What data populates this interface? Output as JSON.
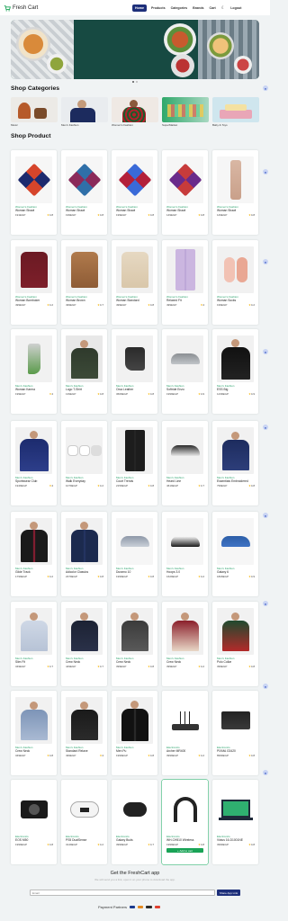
{
  "nav": {
    "brand": "Fresh Cart",
    "links": [
      "Home",
      "Products",
      "Categories",
      "Brands",
      "Cart"
    ],
    "logout": "Logout"
  },
  "sections": {
    "categories_title": "Shop Categories",
    "products_title": "Shop Product"
  },
  "categories": [
    "Music",
    "Men's Fashion",
    "Women's Fashion",
    "SuperMarket",
    "Baby & Toys"
  ],
  "products": [
    {
      "cat": "Women's Fashion",
      "name": "Woman Shawl",
      "price": "191EGP",
      "rating": "4.8"
    },
    {
      "cat": "Women's Fashion",
      "name": "Woman Shawl",
      "price": "199EGP",
      "rating": "4.8"
    },
    {
      "cat": "Women's Fashion",
      "name": "Woman Shawl",
      "price": "199EGP",
      "rating": "4.8"
    },
    {
      "cat": "Women's Fashion",
      "name": "Woman Shawl",
      "price": "149EGP",
      "rating": "4.8"
    },
    {
      "cat": "Women's Fashion",
      "name": "Woman Shawl",
      "price": "149EGP",
      "rating": "4.8"
    },
    {
      "cat": "Women's Fashion",
      "name": "Woman Bomboker",
      "price": "499EGP",
      "rating": "4.2"
    },
    {
      "cat": "Women's Fashion",
      "name": "Woman Brown",
      "price": "499EGP",
      "rating": "4.7"
    },
    {
      "cat": "Women's Fashion",
      "name": "Woman Standard",
      "price": "499EGP",
      "rating": "4.8"
    },
    {
      "cat": "Women's Fashion",
      "name": "Relaxed Fit",
      "price": "499EGP",
      "rating": "4"
    },
    {
      "cat": "Women's Fashion",
      "name": "Woman Socks",
      "price": "199EGP",
      "rating": "4.2"
    },
    {
      "cat": "Men's Fashion",
      "name": "Woman Karma",
      "price": "199EGP",
      "rating": "4"
    },
    {
      "cat": "Men's Fashion",
      "name": "Logo T-Shirt",
      "price": "139EGP",
      "rating": "4.8"
    },
    {
      "cat": "Men's Fashion",
      "name": "Orca Leather",
      "price": "3609EGP",
      "rating": "4.8"
    },
    {
      "cat": "Men's Fashion",
      "name": "Softride Enzo",
      "price": "1999EGP",
      "rating": "4.9"
    },
    {
      "cat": "Men's Fashion",
      "name": "ESS Big",
      "price": "1239EGP",
      "rating": "4.9"
    },
    {
      "cat": "Men's Fashion",
      "name": "Sportswear Club",
      "price": "1949EGP",
      "rating": "4"
    },
    {
      "cat": "Men's Fashion",
      "name": "Walk Everyday",
      "price": "1079EGP",
      "rating": "4.2"
    },
    {
      "cat": "Men's Fashion",
      "name": "Court Trends",
      "price": "2159EGP",
      "rating": "4.8"
    },
    {
      "cat": "Men's Fashion",
      "name": "Heard Line",
      "price": "4619EGP",
      "rating": "4.7"
    },
    {
      "cat": "Men's Fashion",
      "name": "Essentials Embroidered",
      "price": "799EGP",
      "rating": "4.8"
    },
    {
      "cat": "Men's Fashion",
      "name": "Glide Track",
      "price": "1799EGP",
      "rating": "4.2"
    },
    {
      "cat": "Men's Fashion",
      "name": "Adicolor Classics",
      "price": "2379EGP",
      "rating": "4.8"
    },
    {
      "cat": "Men's Fashion",
      "name": "Duramo 10",
      "price": "1999EGP",
      "rating": "4.8"
    },
    {
      "cat": "Men's Fashion",
      "name": "Hoops 3.0",
      "price": "1629EGP",
      "rating": "4.2"
    },
    {
      "cat": "Men's Fashion",
      "name": "Galaxy 6",
      "price": "1829EGP",
      "rating": "4.9"
    },
    {
      "cat": "Men's Fashion",
      "name": "Slim Fit",
      "price": "349EGP",
      "rating": "4.7"
    },
    {
      "cat": "Men's Fashion",
      "name": "Crew Neck",
      "price": "449EGP",
      "rating": "4.7"
    },
    {
      "cat": "Men's Fashion",
      "name": "Crew Neck",
      "price": "399EGP",
      "rating": "4.8"
    },
    {
      "cat": "Men's Fashion",
      "name": "Crew Neck",
      "price": "399EGP",
      "rating": "4.2"
    },
    {
      "cat": "Men's Fashion",
      "name": "Polo Collar",
      "price": "399EGP",
      "rating": "4.8"
    },
    {
      "cat": "Men's Fashion",
      "name": "Crew Neck",
      "price": "349EGP",
      "rating": "4.8"
    },
    {
      "cat": "Men's Fashion",
      "name": "Standard Relaxe",
      "price": "499EGP",
      "rating": "4"
    },
    {
      "cat": "Men's Fashion",
      "name": "Men Pu",
      "price": "1999EGP",
      "rating": "4.8"
    },
    {
      "cat": "Electronics",
      "name": "Archer MR400",
      "price": "3999EGP",
      "rating": "4.2"
    },
    {
      "cat": "Electronics",
      "name": "PIXMA G3420",
      "price": "8999EGP",
      "rating": "4.8"
    },
    {
      "cat": "Electronics",
      "name": "EOS M50",
      "price": "1999EGP",
      "rating": "4.8"
    },
    {
      "cat": "Electronics",
      "name": "PS5 DualSense",
      "price": "3149EGP",
      "rating": "4.2"
    },
    {
      "cat": "Electronics",
      "name": "Galaxy Buds",
      "price": "3999EGP",
      "rating": "4.7"
    },
    {
      "cat": "Electronics",
      "name": "WH-CH510 Wireless",
      "price": "1999EGP",
      "rating": "4.8"
    },
    {
      "cat": "Electronics",
      "name": "Victus 16-D1001NE",
      "price": "3999EGP",
      "rating": "4.8"
    }
  ],
  "add_to_cart": "+ Add to cart",
  "icons": [
    "cart-logo-icon",
    "moon-icon",
    "star-icon"
  ],
  "app_section": {
    "title": "Get the FreshCart app",
    "subtitle": "We will send you a link, open it on your phone to download the app.",
    "email_placeholder": "Email",
    "share_label": "Share App Link"
  },
  "payment": {
    "label": "Payment Partners"
  },
  "colors": {
    "accent": "#1d2f7a",
    "green": "#19a356",
    "category": "#2aa26b",
    "star": "#f5b301"
  }
}
